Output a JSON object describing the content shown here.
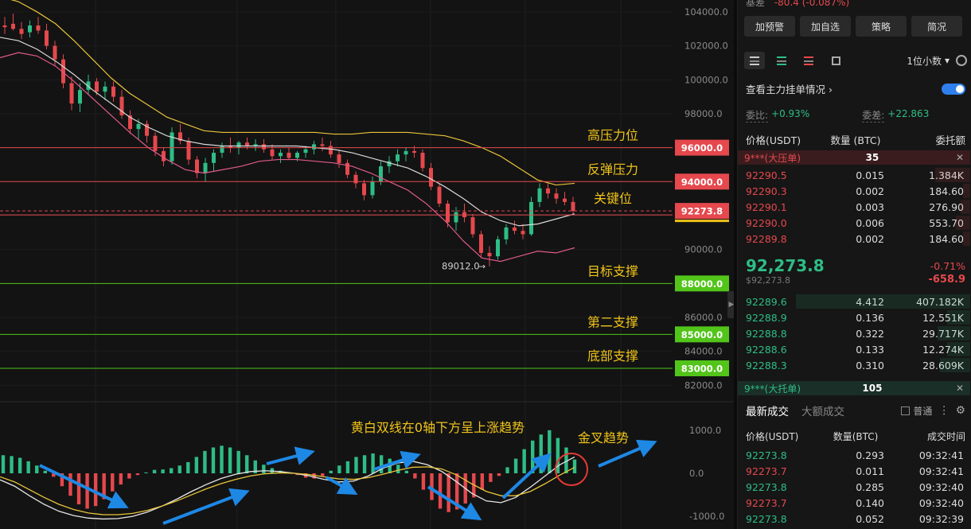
{
  "chart_data": [
    {
      "type": "candlestick",
      "title": "",
      "y_axis_labels": [
        "104000.0",
        "102000.0",
        "100000.0",
        "98000.0",
        "96000.0",
        "94000.0",
        "92000.0",
        "90000.0",
        "88000.0",
        "86000.0",
        "85000.0",
        "84000.0",
        "83000.0",
        "82000.0"
      ],
      "ylim": [
        81500,
        104700
      ],
      "candles": [
        {
          "o": 103200,
          "h": 103700,
          "l": 102700,
          "c": 103100
        },
        {
          "o": 103300,
          "h": 103900,
          "l": 102900,
          "c": 103000
        },
        {
          "o": 103000,
          "h": 103400,
          "l": 102400,
          "c": 102700
        },
        {
          "o": 102800,
          "h": 103500,
          "l": 102500,
          "c": 103200
        },
        {
          "o": 103200,
          "h": 103700,
          "l": 102700,
          "c": 102900
        },
        {
          "o": 102900,
          "h": 103300,
          "l": 101800,
          "c": 102000
        },
        {
          "o": 102000,
          "h": 102300,
          "l": 100800,
          "c": 101200
        },
        {
          "o": 101200,
          "h": 101500,
          "l": 99500,
          "c": 99800
        },
        {
          "o": 99800,
          "h": 100200,
          "l": 98200,
          "c": 98600
        },
        {
          "o": 98600,
          "h": 99800,
          "l": 98100,
          "c": 99400
        },
        {
          "o": 99400,
          "h": 100300,
          "l": 99100,
          "c": 99900
        },
        {
          "o": 99900,
          "h": 100100,
          "l": 99100,
          "c": 99300
        },
        {
          "o": 99300,
          "h": 99900,
          "l": 98800,
          "c": 99600
        },
        {
          "o": 99600,
          "h": 99900,
          "l": 98700,
          "c": 99000
        },
        {
          "o": 99000,
          "h": 99400,
          "l": 97700,
          "c": 97900
        },
        {
          "o": 97900,
          "h": 98200,
          "l": 96800,
          "c": 97100
        },
        {
          "o": 97100,
          "h": 97700,
          "l": 96500,
          "c": 97400
        },
        {
          "o": 97400,
          "h": 97600,
          "l": 96300,
          "c": 96700
        },
        {
          "o": 96700,
          "h": 96900,
          "l": 95500,
          "c": 95800
        },
        {
          "o": 95800,
          "h": 96000,
          "l": 94900,
          "c": 95200
        },
        {
          "o": 95200,
          "h": 97200,
          "l": 95000,
          "c": 96900
        },
        {
          "o": 96900,
          "h": 97400,
          "l": 96200,
          "c": 96400
        },
        {
          "o": 96400,
          "h": 96600,
          "l": 95000,
          "c": 95300
        },
        {
          "o": 95300,
          "h": 95500,
          "l": 94200,
          "c": 94500
        },
        {
          "o": 94500,
          "h": 95400,
          "l": 94000,
          "c": 95100
        },
        {
          "o": 95100,
          "h": 95900,
          "l": 94600,
          "c": 95700
        },
        {
          "o": 95700,
          "h": 96300,
          "l": 95400,
          "c": 96100
        },
        {
          "o": 96100,
          "h": 96600,
          "l": 95700,
          "c": 96000
        },
        {
          "o": 96000,
          "h": 96400,
          "l": 95600,
          "c": 96300
        },
        {
          "o": 96300,
          "h": 96600,
          "l": 95900,
          "c": 96100
        },
        {
          "o": 96100,
          "h": 96500,
          "l": 95800,
          "c": 96200
        },
        {
          "o": 96200,
          "h": 96500,
          "l": 95700,
          "c": 95900
        },
        {
          "o": 95900,
          "h": 96200,
          "l": 95300,
          "c": 95500
        },
        {
          "o": 95500,
          "h": 95900,
          "l": 95100,
          "c": 95700
        },
        {
          "o": 95700,
          "h": 96000,
          "l": 95300,
          "c": 95400
        },
        {
          "o": 95400,
          "h": 95800,
          "l": 95200,
          "c": 95700
        },
        {
          "o": 95700,
          "h": 96100,
          "l": 95400,
          "c": 95900
        },
        {
          "o": 95900,
          "h": 96400,
          "l": 95600,
          "c": 96200
        },
        {
          "o": 96200,
          "h": 96600,
          "l": 95800,
          "c": 96100
        },
        {
          "o": 96100,
          "h": 96400,
          "l": 95400,
          "c": 95600
        },
        {
          "o": 95600,
          "h": 95900,
          "l": 94800,
          "c": 95100
        },
        {
          "o": 95100,
          "h": 95300,
          "l": 94200,
          "c": 94400
        },
        {
          "o": 94400,
          "h": 94600,
          "l": 93600,
          "c": 93900
        },
        {
          "o": 93900,
          "h": 94100,
          "l": 92900,
          "c": 93200
        },
        {
          "o": 93200,
          "h": 94300,
          "l": 93000,
          "c": 94000
        },
        {
          "o": 94000,
          "h": 95200,
          "l": 93800,
          "c": 94900
        },
        {
          "o": 94900,
          "h": 95500,
          "l": 94500,
          "c": 95200
        },
        {
          "o": 95200,
          "h": 95900,
          "l": 94900,
          "c": 95600
        },
        {
          "o": 95600,
          "h": 96000,
          "l": 95200,
          "c": 95800
        },
        {
          "o": 95800,
          "h": 96100,
          "l": 95400,
          "c": 95700
        },
        {
          "o": 95700,
          "h": 95900,
          "l": 94600,
          "c": 94800
        },
        {
          "o": 94800,
          "h": 95100,
          "l": 93500,
          "c": 93700
        },
        {
          "o": 93700,
          "h": 93900,
          "l": 92500,
          "c": 92700
        },
        {
          "o": 92700,
          "h": 92900,
          "l": 91300,
          "c": 91600
        },
        {
          "o": 91600,
          "h": 92500,
          "l": 91100,
          "c": 92200
        },
        {
          "o": 92200,
          "h": 92700,
          "l": 91600,
          "c": 91900
        },
        {
          "o": 91900,
          "h": 92100,
          "l": 90700,
          "c": 90900
        },
        {
          "o": 90900,
          "h": 91100,
          "l": 89500,
          "c": 89800
        },
        {
          "o": 89800,
          "h": 90200,
          "l": 89012,
          "c": 89600
        },
        {
          "o": 89600,
          "h": 90800,
          "l": 89400,
          "c": 90600
        },
        {
          "o": 90600,
          "h": 91500,
          "l": 90300,
          "c": 91300
        },
        {
          "o": 91300,
          "h": 91700,
          "l": 90900,
          "c": 91100
        },
        {
          "o": 91100,
          "h": 91500,
          "l": 90600,
          "c": 90900
        },
        {
          "o": 90900,
          "h": 93100,
          "l": 90800,
          "c": 92800
        },
        {
          "o": 92800,
          "h": 93900,
          "l": 92500,
          "c": 93600
        },
        {
          "o": 93600,
          "h": 93900,
          "l": 93000,
          "c": 93300
        },
        {
          "o": 93300,
          "h": 93600,
          "l": 92700,
          "c": 93000
        },
        {
          "o": 93000,
          "h": 93400,
          "l": 92600,
          "c": 92800
        },
        {
          "o": 92800,
          "h": 93100,
          "l": 92100,
          "c": 92274
        }
      ],
      "bollinger": {
        "upper_color": "#e8c43a",
        "mid_color": "#d9d9d9",
        "lower_color": "#e05a8c",
        "upper": [
          104900,
          104600,
          104000,
          103300,
          102300,
          101200,
          100100,
          99200,
          98500,
          97800,
          97400,
          97000,
          96900,
          96900,
          96900,
          96900,
          96900,
          96900,
          96800,
          96800,
          96900,
          96900,
          96900,
          96800,
          96700,
          96400,
          96000,
          95500,
          94800,
          94100,
          93800,
          93900
        ],
        "mid": [
          102500,
          102300,
          101800,
          101100,
          100300,
          99400,
          98600,
          97800,
          97200,
          96700,
          96400,
          96200,
          96100,
          96100,
          96100,
          96100,
          96100,
          96000,
          95900,
          95700,
          95400,
          95100,
          94800,
          94300,
          93700,
          93000,
          92200,
          91700,
          91400,
          91500,
          91800,
          92100
        ],
        "lower": [
          101300,
          101600,
          101400,
          100800,
          99900,
          98900,
          97900,
          96900,
          96000,
          95300,
          94700,
          94500,
          94700,
          94900,
          95200,
          95300,
          95300,
          95200,
          95100,
          94900,
          94500,
          94000,
          93500,
          92700,
          91700,
          90500,
          89500,
          89300,
          89600,
          89900,
          89800,
          90100
        ]
      },
      "levels": [
        {
          "price": 96000,
          "label": "高压力位",
          "tag": "96000.0",
          "color": "#e5484d"
        },
        {
          "price": 94000,
          "label": "反弹压力",
          "tag": "94000.0",
          "color": "#e5484d"
        },
        {
          "price": 92273.8,
          "label": "关键位",
          "tag": "92273.8",
          "color": "#e5484d"
        },
        {
          "price": 88000,
          "label": "目标支撑",
          "tag": "88000.0",
          "color": "#52c41a"
        },
        {
          "price": 85000,
          "label": "第二支撑",
          "tag": "85000.0",
          "color": "#52c41a"
        },
        {
          "price": 83000,
          "label": "底部支撑",
          "tag": "83000.0",
          "color": "#52c41a"
        }
      ],
      "low_marker": "89012.0",
      "current_price_color": "#e5484d"
    },
    {
      "type": "macd",
      "y_axis_labels": [
        "1000.0",
        "0.0",
        "-1000.0"
      ],
      "ylim": [
        -1200,
        1200
      ],
      "annotations": [
        "黄白双线在0轴下方呈上涨趋势",
        "金叉趋势"
      ],
      "histogram": [
        420,
        400,
        360,
        280,
        180,
        60,
        -80,
        -300,
        -520,
        -720,
        -820,
        -760,
        -600,
        -420,
        -260,
        -120,
        -40,
        20,
        80,
        90,
        120,
        180,
        260,
        380,
        520,
        600,
        640,
        600,
        520,
        420,
        300,
        200,
        120,
        60,
        20,
        -40,
        -100,
        -120,
        -60,
        60,
        180,
        280,
        380,
        420,
        460,
        420,
        340,
        200,
        60,
        -120,
        -380,
        -620,
        -820,
        -900,
        -840,
        -700,
        -560,
        -380,
        -200,
        -60,
        140,
        340,
        560,
        760,
        900,
        1000,
        820,
        600,
        320
      ],
      "dif": [
        -150,
        -300,
        -520,
        -720,
        -880,
        -980,
        -1040,
        -1060,
        -1050,
        -1000,
        -900,
        -760,
        -600,
        -420,
        -260,
        -120,
        -20,
        40,
        60,
        40,
        0,
        -60,
        -140,
        -200,
        -180,
        -60,
        120,
        240,
        280,
        200,
        40,
        -200,
        -460,
        -640,
        -680,
        -560,
        -320,
        -60,
        200,
        380
      ],
      "dea": [
        -80,
        -200,
        -380,
        -560,
        -720,
        -840,
        -920,
        -960,
        -960,
        -930,
        -860,
        -760,
        -640,
        -500,
        -360,
        -240,
        -140,
        -60,
        -10,
        10,
        0,
        -30,
        -80,
        -130,
        -140,
        -100,
        -20,
        70,
        140,
        150,
        100,
        -40,
        -240,
        -420,
        -520,
        -520,
        -420,
        -240,
        -40,
        140
      ]
    }
  ],
  "side": {
    "header_label": "基差",
    "header_value": "-80.4 (-0.087%)",
    "buttons": [
      "加预警",
      "加自选",
      "策略",
      "简况"
    ],
    "decimal": "1位小数",
    "toggle_label": "查看主力挂单情况",
    "stat1_label": "委比:",
    "stat1_value": "+0.93%",
    "stat2_label": "委差:",
    "stat2_value": "+22.863",
    "ob_headers": [
      "价格(USDT)",
      "数量 (BTC)",
      "委托额"
    ],
    "ask_big_name": "9***(大压单)",
    "ask_big_qty": "35",
    "bid_big_name": "9***(大托单)",
    "bid_big_qty": "105",
    "asks": [
      {
        "p": "92290.5",
        "q": "0.015",
        "t": "1.384K",
        "d": 0.15
      },
      {
        "p": "92290.3",
        "q": "0.002",
        "t": "184.60",
        "d": 0.03
      },
      {
        "p": "92290.1",
        "q": "0.003",
        "t": "276.90",
        "d": 0.04
      },
      {
        "p": "92290.0",
        "q": "0.006",
        "t": "553.70",
        "d": 0.06
      },
      {
        "p": "92289.8",
        "q": "0.002",
        "t": "184.60",
        "d": 0.03
      }
    ],
    "last_price": "92,273.8",
    "mark_price": "$92,273.8",
    "change_pct": "-0.71%",
    "change_abs": "-658.9",
    "bids": [
      {
        "p": "92289.6",
        "q": "4.412",
        "t": "407.182K",
        "d": 0.75
      },
      {
        "p": "92288.9",
        "q": "0.136",
        "t": "12.551K",
        "d": 0.1
      },
      {
        "p": "92288.8",
        "q": "0.322",
        "t": "29.717K",
        "d": 0.14
      },
      {
        "p": "92288.6",
        "q": "0.133",
        "t": "12.274K",
        "d": 0.1
      },
      {
        "p": "92288.3",
        "q": "0.310",
        "t": "28.609K",
        "d": 0.13
      }
    ],
    "trade_tabs": [
      "最新成交",
      "大额成交"
    ],
    "trade_check": "普通",
    "trade_headers": [
      "价格(USDT)",
      "数量(BTC)",
      "成交时间"
    ],
    "trades": [
      {
        "p": "92273.8",
        "side": "buy",
        "q": "0.293",
        "t": "09:32:41"
      },
      {
        "p": "92273.7",
        "side": "sell",
        "q": "0.011",
        "t": "09:32:41"
      },
      {
        "p": "92273.8",
        "side": "buy",
        "q": "0.285",
        "t": "09:32:40"
      },
      {
        "p": "92273.7",
        "side": "sell",
        "q": "0.140",
        "t": "09:32:40"
      },
      {
        "p": "92273.8",
        "side": "buy",
        "q": "0.052",
        "t": "09:32:39"
      }
    ]
  }
}
